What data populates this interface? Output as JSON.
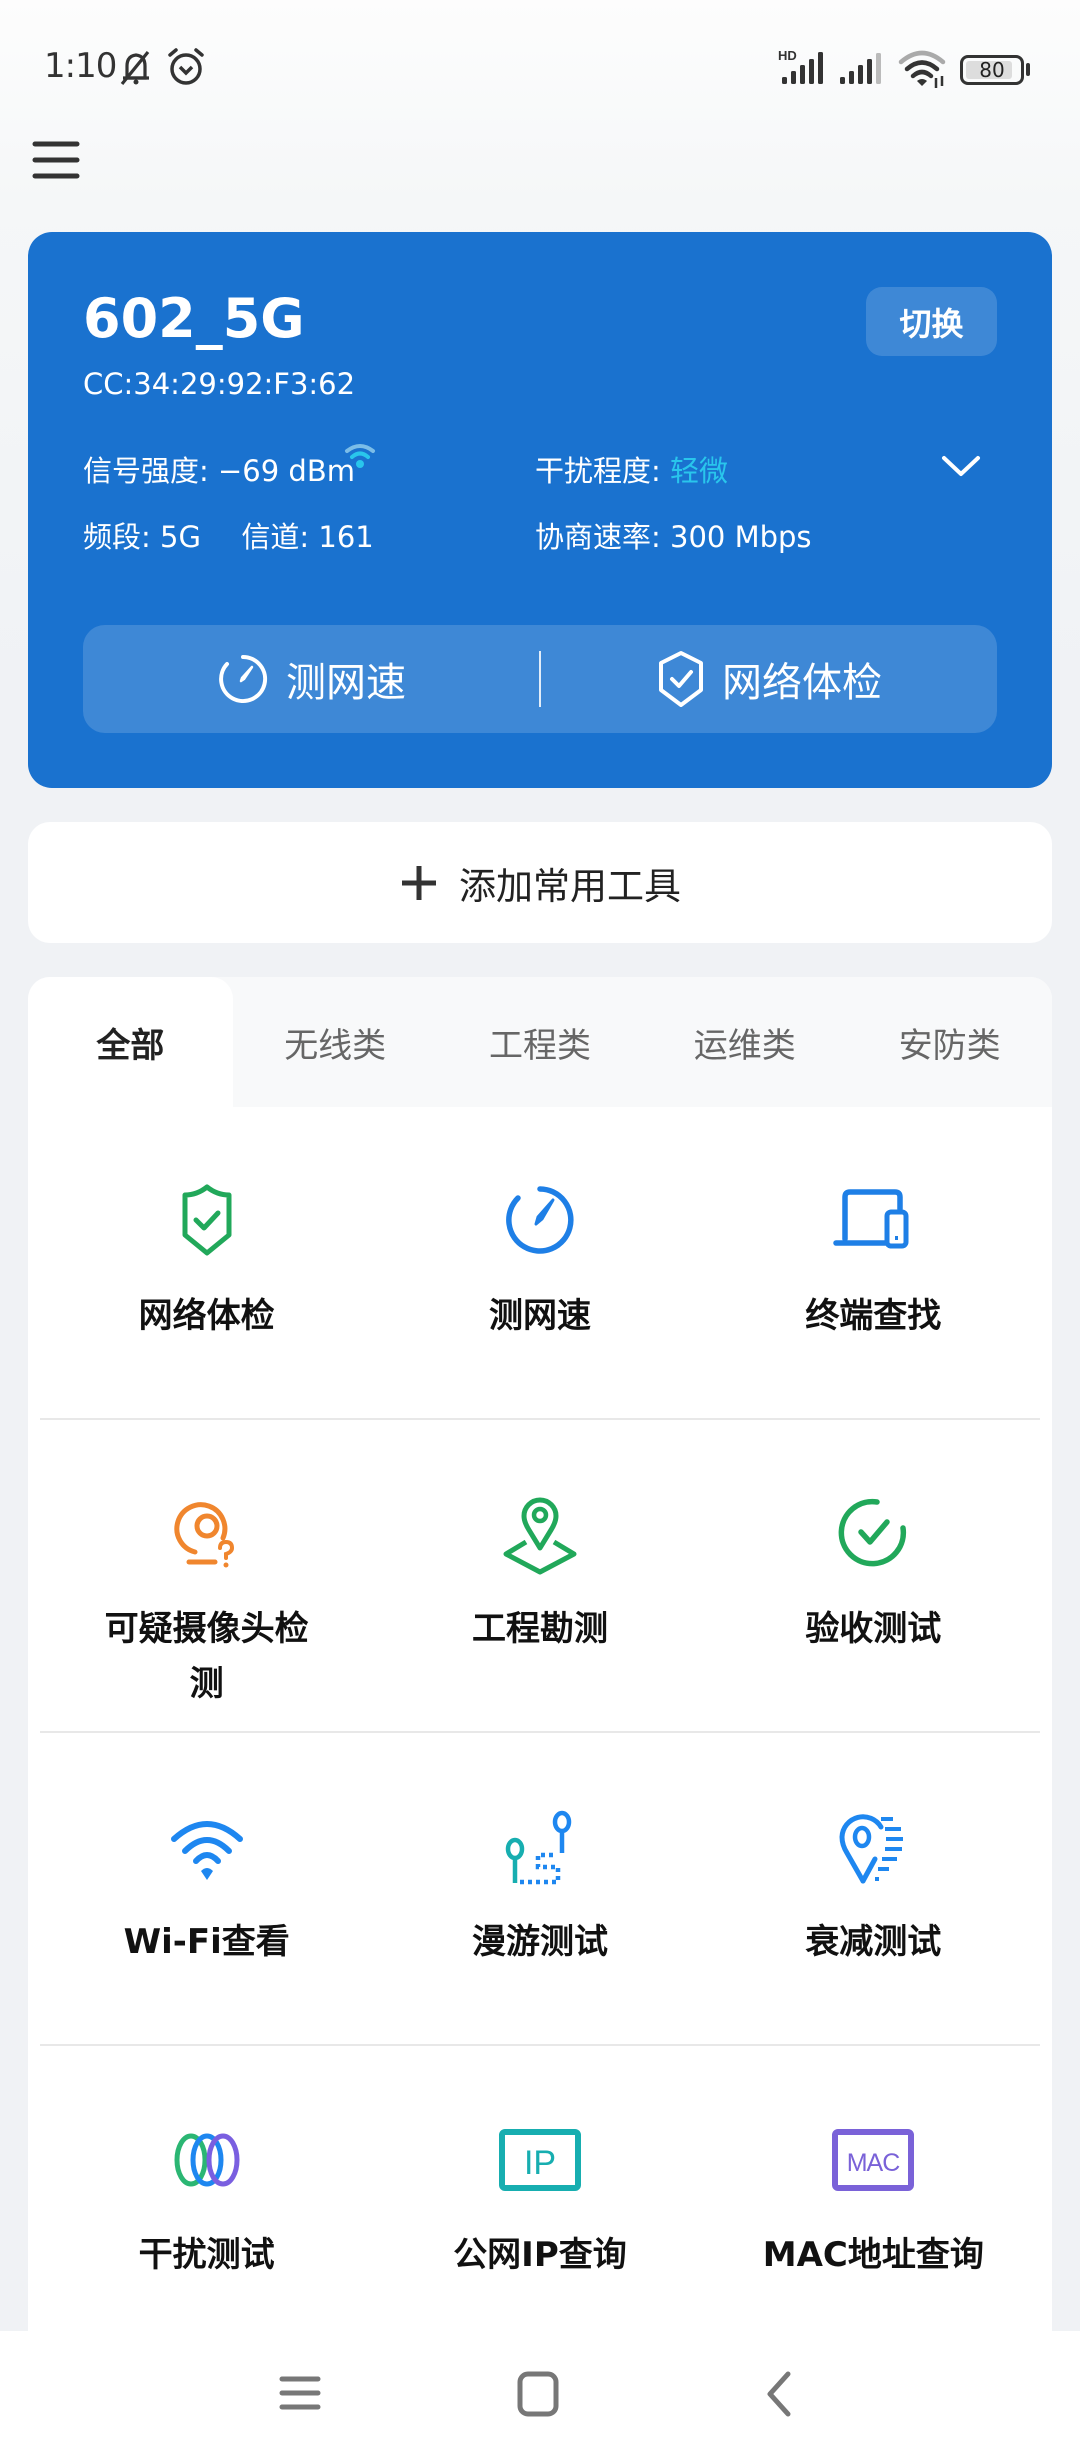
{
  "status_bar": {
    "time": "1:10",
    "icons": [
      "mute-icon",
      "alarm-icon",
      "hd-signal-icon",
      "signal-icon",
      "wifi-icon"
    ],
    "battery": "80"
  },
  "header": {
    "menu_icon": "hamburger-menu-icon"
  },
  "wifi_card": {
    "ssid": "602_5G",
    "mac": "CC:34:29:92:F3:62",
    "switch_label": "切换",
    "signal_label": "信号强度:",
    "signal_value": "−69 dBm",
    "interference_label": "干扰程度:",
    "interference_value": "轻微",
    "band_label": "频段:",
    "band_value": "5G",
    "channel_label": "信道:",
    "channel_value": "161",
    "rate_label": "协商速率:",
    "rate_value": "300 Mbps",
    "accent_color": "#29c6ec",
    "background_color": "#1a72cf",
    "actions": [
      {
        "label": "测网速",
        "icon": "speedometer-icon"
      },
      {
        "label": "网络体检",
        "icon": "shield-check-icon"
      }
    ]
  },
  "add_tools": {
    "label": "添加常用工具",
    "icon": "plus-icon"
  },
  "tabs": [
    {
      "label": "全部",
      "active": true
    },
    {
      "label": "无线类",
      "active": false
    },
    {
      "label": "工程类",
      "active": false
    },
    {
      "label": "运维类",
      "active": false
    },
    {
      "label": "安防类",
      "active": false
    }
  ],
  "tools": [
    {
      "label": "网络体检",
      "icon": "shield-check-icon",
      "color": "#21a85a"
    },
    {
      "label": "测网速",
      "icon": "speedometer-icon",
      "color": "#1e7fe6"
    },
    {
      "label": "终端查找",
      "icon": "devices-icon",
      "color": "#1e7fe6"
    },
    {
      "label": "可疑摄像头检测",
      "icon": "camera-question-icon",
      "color": "#f0862e"
    },
    {
      "label": "工程勘测",
      "icon": "map-pin-area-icon",
      "color": "#21a85a"
    },
    {
      "label": "验收测试",
      "icon": "check-circle-icon",
      "color": "#21a85a"
    },
    {
      "label": "Wi-Fi查看",
      "icon": "wifi-icon",
      "color": "#1e87f0"
    },
    {
      "label": "漫游测试",
      "icon": "roaming-path-icon",
      "color": "#1e87f0"
    },
    {
      "label": "衰减测试",
      "icon": "pin-attenuation-icon",
      "color": "#1e87f0"
    },
    {
      "label": "干扰测试",
      "icon": "interference-rings-icon",
      "color": "#7a5fe0"
    },
    {
      "label": "公网IP查询",
      "icon": "ip-box-icon",
      "color": "#17aeb0"
    },
    {
      "label": "MAC地址查询",
      "icon": "mac-box-icon",
      "color": "#7a62d8"
    }
  ],
  "navbar": {
    "icons": [
      "recents-icon",
      "home-icon",
      "back-icon"
    ]
  }
}
